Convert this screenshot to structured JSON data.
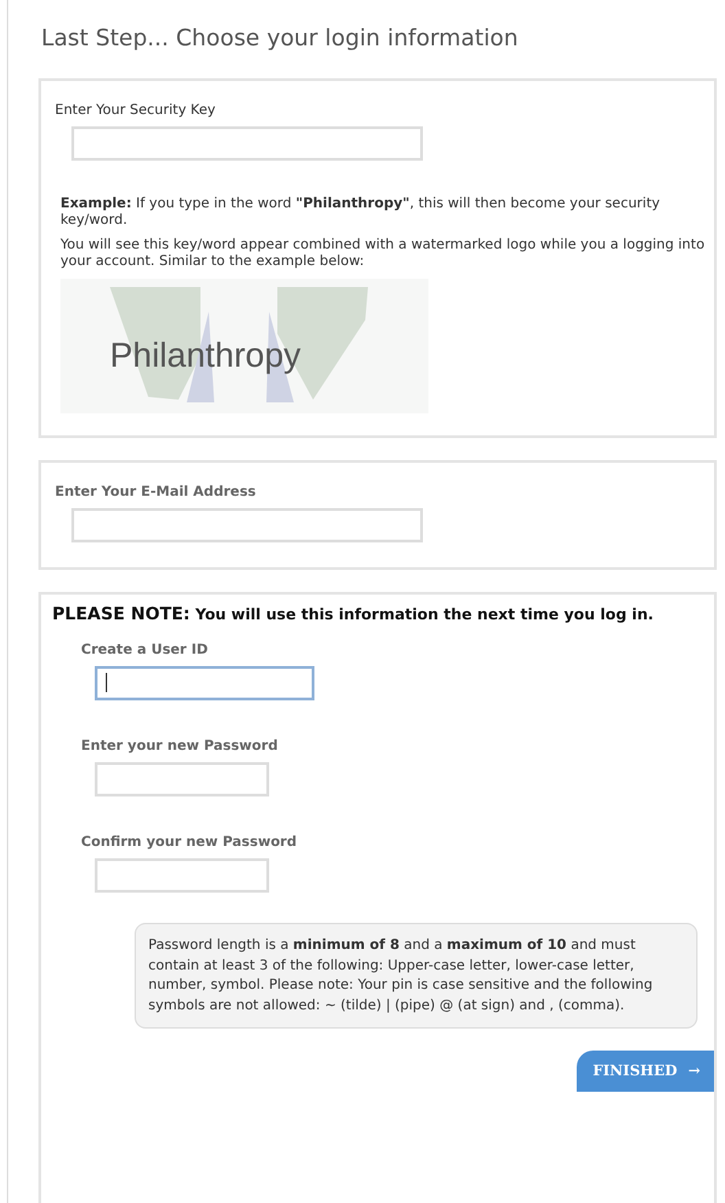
{
  "title": "Last Step... Choose your login information",
  "security": {
    "label": "Enter Your Security Key",
    "example": "**Example:** If you type in the word **\"Philanthropy\"**, this will then become your security key/word.",
    "note": "You will see this key/word appear combined with a watermarked logo while you a logging into your account. Similar to the example below:",
    "sample_word": "Philanthropy"
  },
  "email": {
    "label": "Enter Your E-Mail Address"
  },
  "account": {
    "notice_lead": "PLEASE NOTE:",
    "notice": "You will use this information the next time you log in.",
    "fields": [
      {
        "label": "Create a User ID",
        "focused": true
      },
      {
        "label": "Enter your new Password",
        "focused": false
      },
      {
        "label": "Confirm your new Password",
        "focused": false
      }
    ],
    "rules": "Password length is a **minimum of 8** and a **maximum of 10** and must contain at least 3 of the following: Upper-case letter, lower-case letter, number, symbol. Please note: Your pin is case sensitive and the following symbols are not allowed: ~ (tilde) | (pipe) @ (at sign) and , (comma).",
    "finish": {
      "label": "FINISHED",
      "arrow": "→"
    }
  }
}
